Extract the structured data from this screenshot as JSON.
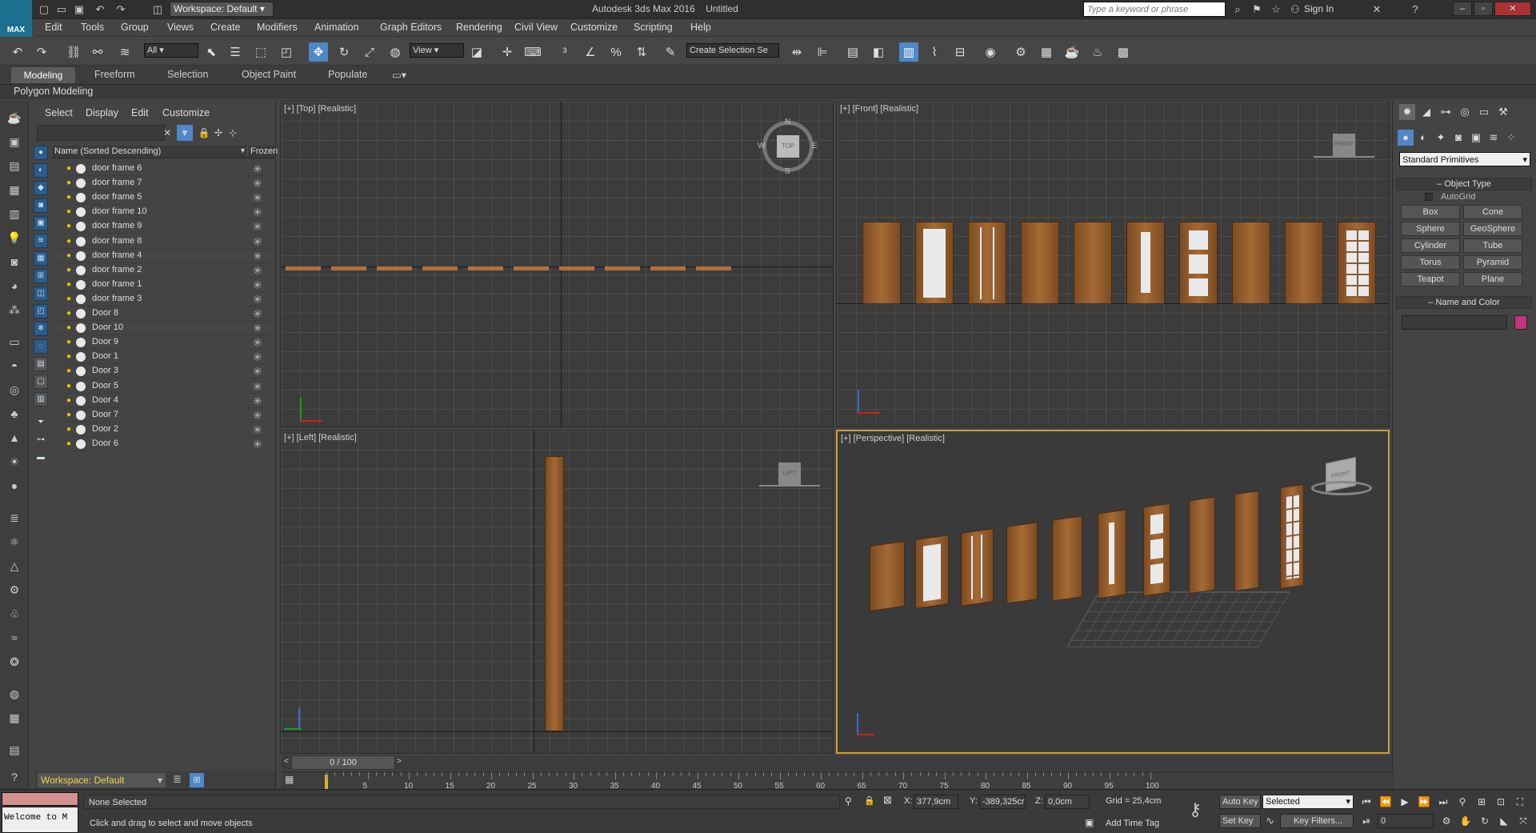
{
  "app": {
    "title": "Autodesk 3ds Max 2016",
    "file": "Untitled",
    "logo": "MAX",
    "workspace": "Workspace: Default",
    "search_placeholder": "Type a keyword or phrase",
    "sign_in": "Sign In"
  },
  "menu": [
    "Edit",
    "Tools",
    "Group",
    "Views",
    "Create",
    "Modifiers",
    "Animation",
    "Graph Editors",
    "Rendering",
    "Civil View",
    "Customize",
    "Scripting",
    "Help"
  ],
  "toolbar": {
    "filter": "All",
    "ref_coord": "View",
    "selection_set": "Create Selection Se",
    "snap_label": "3",
    "angle_label": "n"
  },
  "ribbon": {
    "tabs": [
      "Modeling",
      "Freeform",
      "Selection",
      "Object Paint",
      "Populate"
    ],
    "active": "Modeling",
    "panel": "Polygon Modeling"
  },
  "explorer": {
    "menu": [
      "Select",
      "Display",
      "Edit",
      "Customize"
    ],
    "col_name": "Name (Sorted Descending)",
    "col_frozen": "Frozen",
    "items": [
      "door frame 6",
      "door frame 7",
      "door frame 5",
      "door frame 10",
      "door frame 9",
      "door frame 8",
      "door frame 4",
      "door frame 2",
      "door frame 1",
      "door frame 3",
      "Door 8",
      "Door 10",
      "Door 9",
      "Door 1",
      "Door 3",
      "Door 5",
      "Door 4",
      "Door 7",
      "Door 2",
      "Door 6"
    ],
    "workspace": "Workspace: Default"
  },
  "viewports": {
    "top": "[+] [Top] [Realistic]",
    "front": "[+] [Front] [Realistic]",
    "left": "[+] [Left] [Realistic]",
    "perspective": "[+] [Perspective] [Realistic]"
  },
  "viewcube": {
    "top": "TOP",
    "front": "FRONT",
    "left": "LEFT",
    "n": "N",
    "s": "S",
    "e": "E",
    "w": "W"
  },
  "command_panel": {
    "category": "Standard Primitives",
    "object_type": "Object Type",
    "autogrid": "AutoGrid",
    "buttons": [
      "Box",
      "Cone",
      "Sphere",
      "GeoSphere",
      "Cylinder",
      "Tube",
      "Torus",
      "Pyramid",
      "Teapot",
      "Plane"
    ],
    "name_color": "Name and Color",
    "color": "#c2347b"
  },
  "timeline": {
    "frame": "0 / 100",
    "ticks": [
      "5",
      "10",
      "15",
      "20",
      "25",
      "30",
      "35",
      "40",
      "45",
      "50",
      "55",
      "60",
      "65",
      "70",
      "75",
      "80",
      "85",
      "90",
      "95",
      "100"
    ]
  },
  "status": {
    "maxscript": "Welcome to M",
    "selection": "None Selected",
    "prompt": "Click and drag to select and move objects",
    "x_label": "X:",
    "x": "377,9cm",
    "y_label": "Y:",
    "y": "-389,325cr",
    "z_label": "Z:",
    "z": "0,0cm",
    "grid": "Grid = 25,4cm",
    "add_time_tag": "Add Time Tag",
    "auto_key": "Auto Key",
    "set_key": "Set Key",
    "selected": "Selected",
    "key_filters": "Key Filters...",
    "frame": "0"
  }
}
